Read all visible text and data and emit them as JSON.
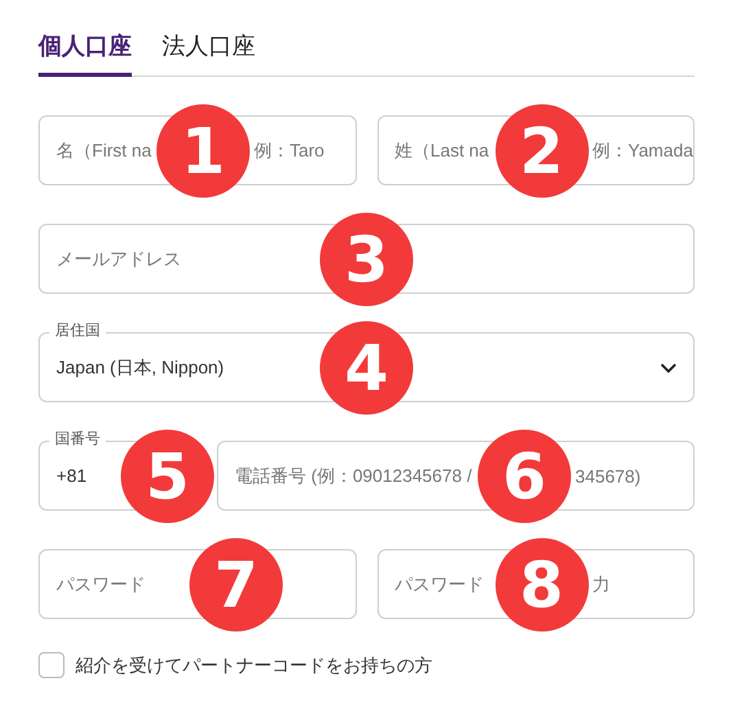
{
  "tabs": [
    {
      "label": "個人口座",
      "selected": true
    },
    {
      "label": "法人口座",
      "selected": false
    }
  ],
  "rows": [
    [
      {
        "kind": "input",
        "placeholder_parts": [
          "名（First na",
          "例：Taro"
        ],
        "badge": "1"
      },
      {
        "kind": "input",
        "placeholder_parts": [
          "姓（Last na",
          "例：Yamada"
        ],
        "badge": "2"
      }
    ],
    [
      {
        "kind": "input",
        "placeholder_parts": [
          "メールアドレス"
        ],
        "badge": "3"
      }
    ],
    [
      {
        "kind": "select",
        "label": "居住国",
        "value": "Japan (日本, Nippon)",
        "badge": "4"
      }
    ],
    [
      {
        "kind": "code",
        "label": "国番号",
        "value": "+81",
        "badge": "5"
      },
      {
        "kind": "input",
        "placeholder_parts": [
          "電話番号 (例：09012345678 /",
          "345678)"
        ],
        "badge": "6"
      }
    ],
    [
      {
        "kind": "input",
        "placeholder_parts": [
          "パスワード"
        ],
        "badge": "7"
      },
      {
        "kind": "input",
        "placeholder_parts": [
          "パスワード",
          "力"
        ],
        "badge": "8"
      }
    ]
  ],
  "checkbox": {
    "label": "紹介を受けてパートナーコードをお持ちの方",
    "checked": false
  }
}
